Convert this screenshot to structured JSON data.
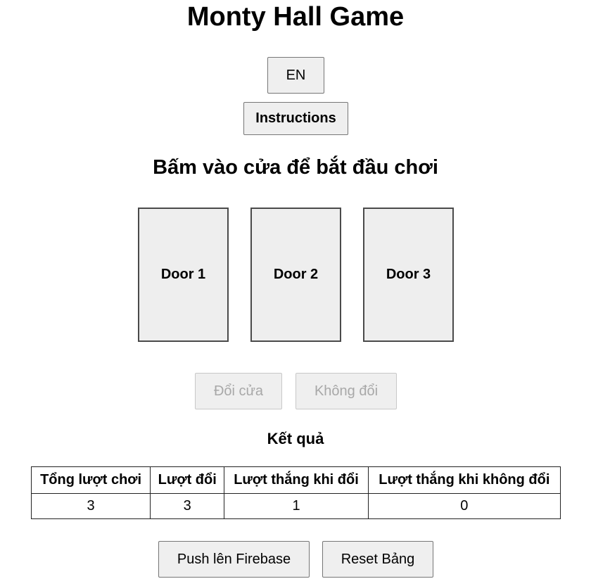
{
  "header": {
    "title": "Monty Hall Game"
  },
  "controls": {
    "language_label": "EN",
    "instructions_label": "Instructions"
  },
  "game": {
    "prompt": "Bấm vào cửa để bắt đầu chơi",
    "doors": [
      {
        "label": "Door 1"
      },
      {
        "label": "Door 2"
      },
      {
        "label": "Door 3"
      }
    ],
    "switch_label": "Đổi cửa",
    "stay_label": "Không đổi"
  },
  "results": {
    "title": "Kết quả",
    "columns": [
      "Tổng lượt chơi",
      "Lượt đổi",
      "Lượt thắng khi đổi",
      "Lượt thắng khi không đổi"
    ],
    "values": [
      "3",
      "3",
      "1",
      "0"
    ]
  },
  "footer": {
    "push_label": "Push lên Firebase",
    "reset_label": "Reset Bảng"
  }
}
